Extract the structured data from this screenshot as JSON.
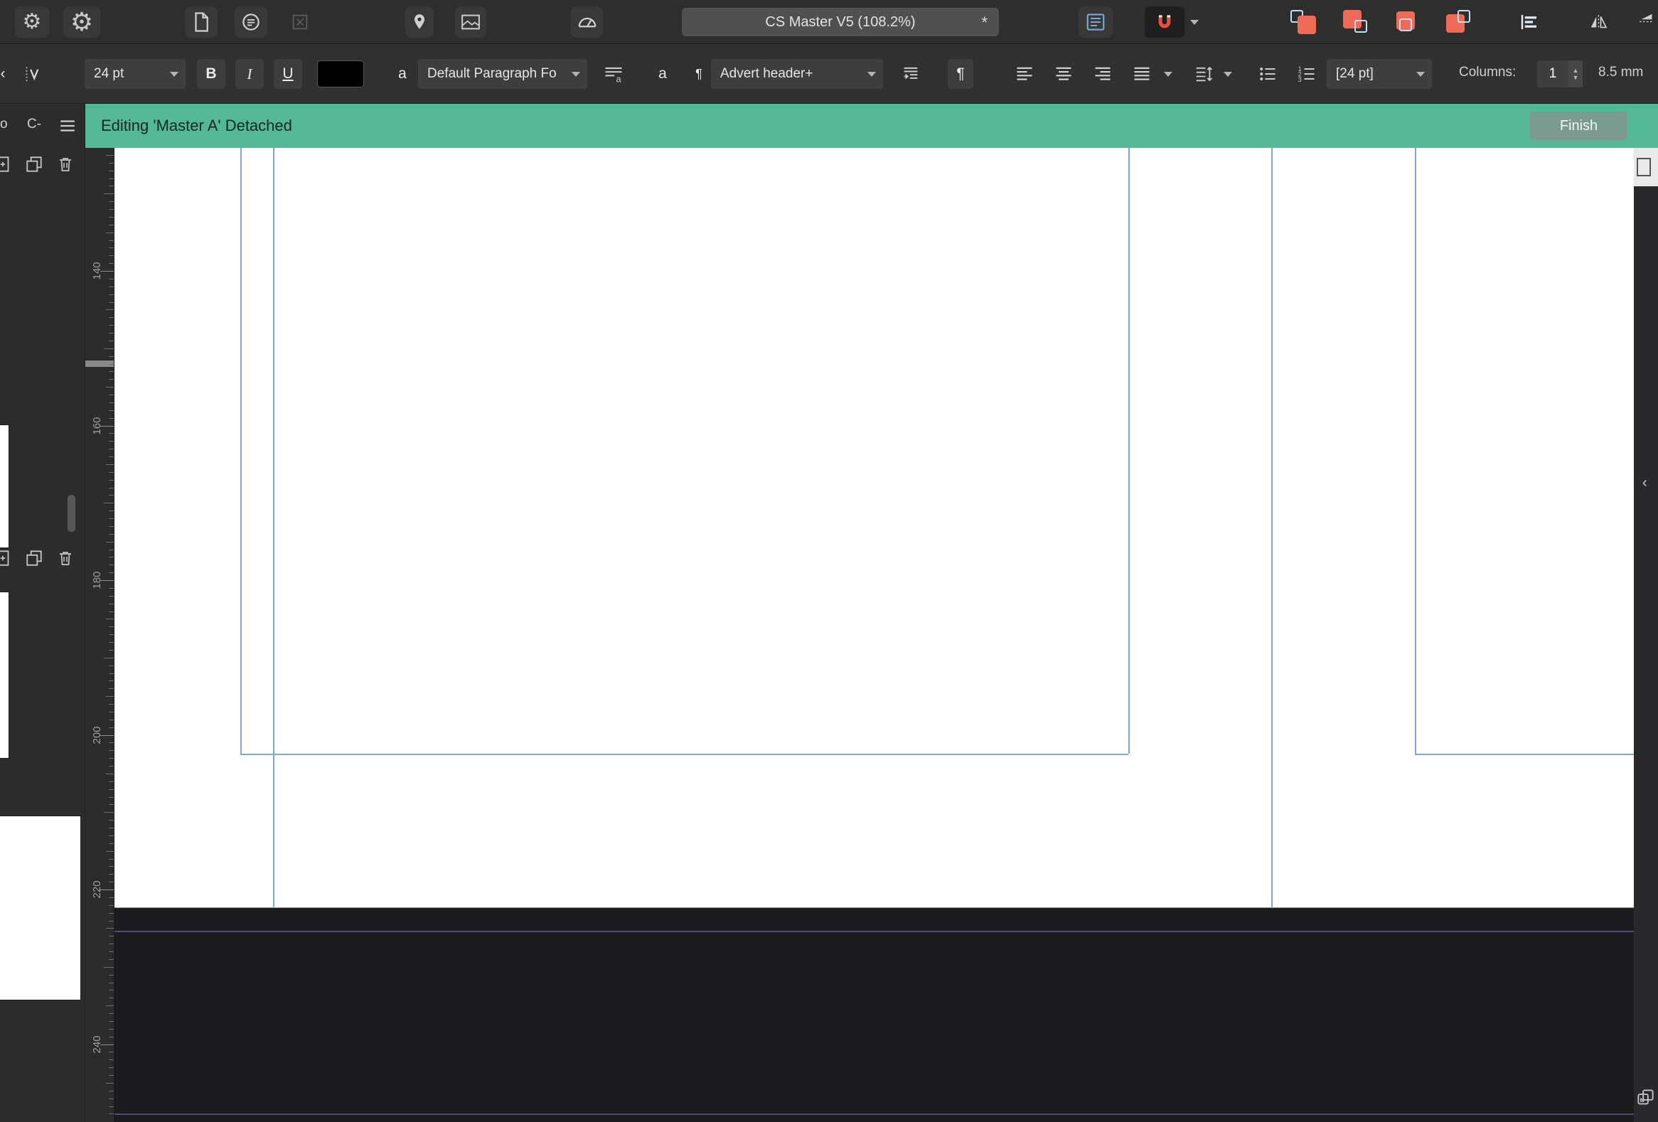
{
  "main_toolbar": {
    "document_dropdown": "CS Master V5 (108.2%)",
    "modified_indicator": "*"
  },
  "context_toolbar": {
    "font_size": "24 pt",
    "bold_label": "B",
    "italic_label": "I",
    "underline_label": "U",
    "char_color_label": "a",
    "paragraph_style": "Default Paragraph Fo",
    "style_letter": "a",
    "pilcrow": "¶",
    "character_style": "Advert header+",
    "leading_value": "[24 pt]",
    "columns_label": "Columns:",
    "columns_value": "1",
    "gutter_value": "8.5 mm"
  },
  "edit_banner": {
    "message": "Editing 'Master A' Detached",
    "finish_label": "Finish",
    "color": "#54b795"
  },
  "pages_panel": {
    "cut_text": "o",
    "compact_label": "C-"
  },
  "ruler": {
    "labels": [
      "140",
      "160",
      "180",
      "200",
      "220",
      "240"
    ]
  },
  "colors": {
    "guide_blue": "#7ea6d8",
    "magnet_red": "#e8503e",
    "arrange_coral": "#ef6a57",
    "page_black_rect": "#1c1c1f"
  }
}
